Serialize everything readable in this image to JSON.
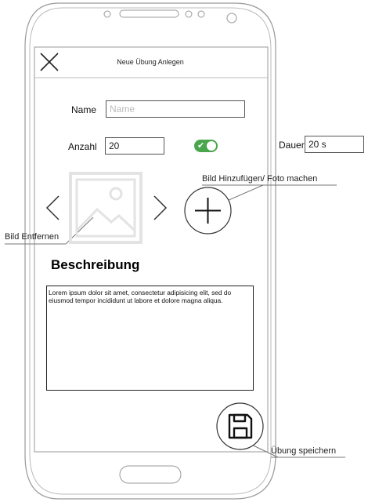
{
  "screen": {
    "title": "Neue Übung Anlegen"
  },
  "form": {
    "name_label": "Name",
    "name_placeholder": "Name",
    "count_label": "Anzahl",
    "count_value": "20",
    "duration_label": "Dauer",
    "duration_value": "20 s",
    "toggle_checked": true
  },
  "description": {
    "heading": "Beschreibung",
    "text": "Lorem ipsum dolor sit amet, consectetur adipisicing elit, sed do eiusmod tempor incididunt ut labore et dolore magna aliqua."
  },
  "annotations": {
    "add_image": "Bild Hinzufügen/ Foto machen",
    "remove_image": "Bild Entfernen",
    "save": "Übung speichern"
  },
  "icons": {
    "close": "close-icon",
    "prev": "chevron-left-icon",
    "next": "chevron-right-icon",
    "image": "image-placeholder-icon",
    "add": "plus-icon",
    "save": "floppy-disk-icon"
  },
  "colors": {
    "toggle_on": "#49a64c",
    "outline": "#555555"
  }
}
